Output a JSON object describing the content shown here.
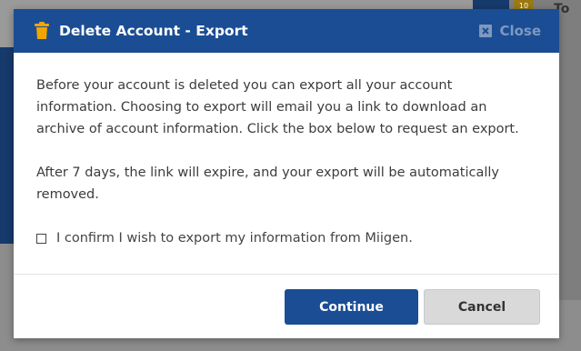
{
  "background": {
    "badge_count": "10",
    "corner_text": "To"
  },
  "dialog": {
    "title": "Delete Account - Export",
    "close_label": "Close",
    "paragraph1": "Before your account is deleted you can export all your account information. Choosing to export will email you a link to download an archive of account information. Click the box below to request an export.",
    "paragraph2": "After 7 days, the link will expire, and your export will be automatically removed.",
    "confirm_label": "I confirm I wish to export my information from Miigen.",
    "confirm_checked": false,
    "continue_label": "Continue",
    "cancel_label": "Cancel"
  },
  "colors": {
    "header": "#1a4d94",
    "primary_button": "#1a4d94",
    "secondary_button": "#d9d9d9",
    "trash_icon": "#f0a500"
  },
  "icons": {
    "title_icon": "trash-icon",
    "close_icon": "close-box-icon"
  }
}
